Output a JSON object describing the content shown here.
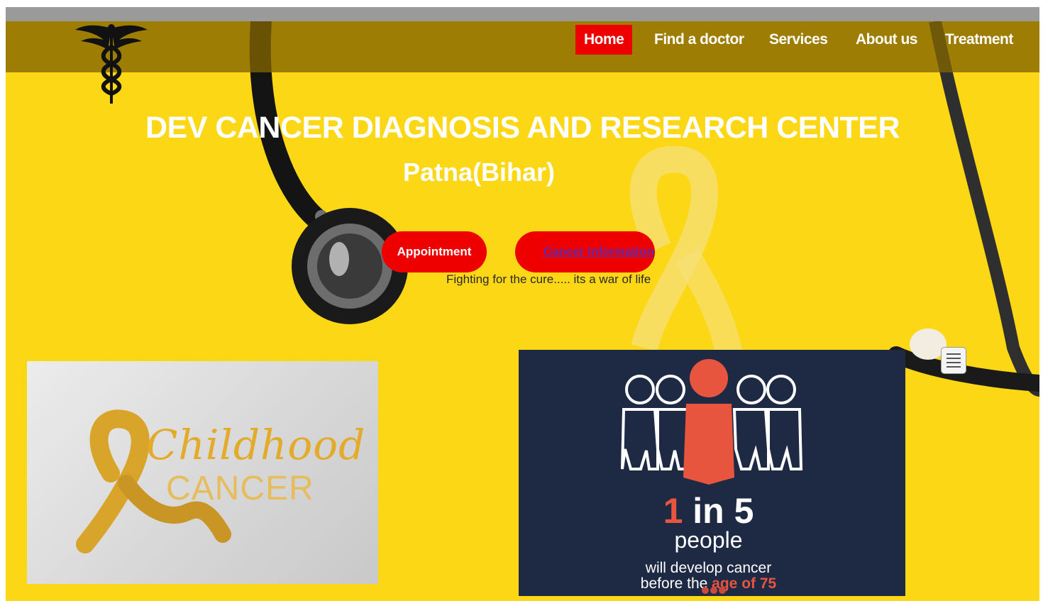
{
  "nav": {
    "logo_icon": "caduceus-icon",
    "items": [
      {
        "label": "Home",
        "active": true
      },
      {
        "label": "Find a doctor",
        "active": false
      },
      {
        "label": "Services",
        "active": false
      },
      {
        "label": "About us",
        "active": false
      },
      {
        "label": "Treatment",
        "active": false
      }
    ]
  },
  "hero": {
    "title": "DEV CANCER DIAGNOSIS AND RESEARCH CENTER",
    "subtitle": "Patna(Bihar)",
    "appointment_label": "Appointment",
    "cancer_info_label": "Cancer Information",
    "tagline": "Fighting for the cure..... its a war of life"
  },
  "cards": {
    "left": {
      "script_word": "Childhood",
      "word": "CANCER"
    },
    "right": {
      "big_one": "1",
      "big_rest": " in 5",
      "people": "people",
      "line1": "will develop cancer",
      "line2_pre": "before the ",
      "line2_emph": "age of 75"
    }
  },
  "colors": {
    "background": "#fcd716",
    "accent": "#ef0000",
    "navbar": "#826400",
    "info_link": "#5b2bb0",
    "highlight": "#e8553f",
    "card_dark": "#1e2a44"
  },
  "menu_icon": "hamburger-menu-icon"
}
